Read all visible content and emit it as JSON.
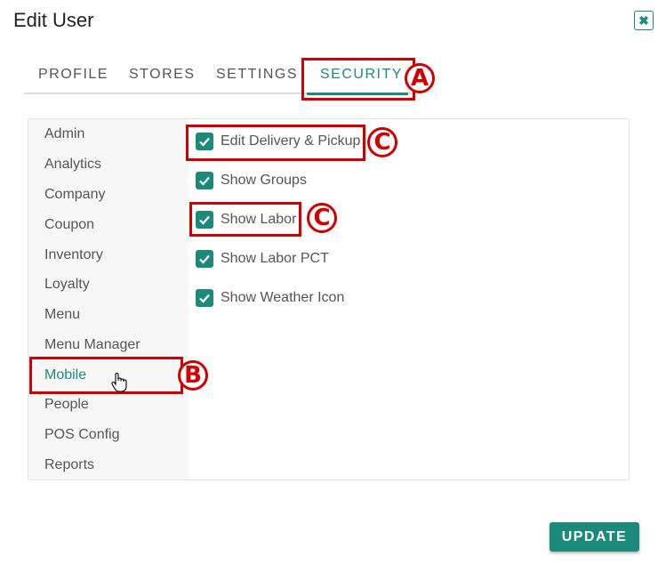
{
  "dialog": {
    "title": "Edit User",
    "close_icon": "close-icon"
  },
  "tabs": [
    {
      "label": "PROFILE"
    },
    {
      "label": "STORES"
    },
    {
      "label": "SETTINGS"
    },
    {
      "label": "SECURITY",
      "active": true
    }
  ],
  "sidebar": {
    "items": [
      {
        "label": "Admin"
      },
      {
        "label": "Analytics"
      },
      {
        "label": "Company"
      },
      {
        "label": "Coupon"
      },
      {
        "label": "Inventory"
      },
      {
        "label": "Loyalty"
      },
      {
        "label": "Menu"
      },
      {
        "label": "Menu Manager"
      },
      {
        "label": "Mobile",
        "active": true
      },
      {
        "label": "People"
      },
      {
        "label": "POS Config"
      },
      {
        "label": "Reports"
      }
    ]
  },
  "permissions": [
    {
      "label": "Edit Delivery & Pickup",
      "checked": true
    },
    {
      "label": "Show Groups",
      "checked": true
    },
    {
      "label": "Show Labor",
      "checked": true
    },
    {
      "label": "Show Labor PCT",
      "checked": true
    },
    {
      "label": "Show Weather Icon",
      "checked": true
    }
  ],
  "annotations": {
    "a": "A",
    "b": "B",
    "c1": "C",
    "c2": "C"
  },
  "actions": {
    "update_label": "UPDATE"
  },
  "colors": {
    "accent": "#1b8a7a",
    "annotation": "#d40000"
  }
}
